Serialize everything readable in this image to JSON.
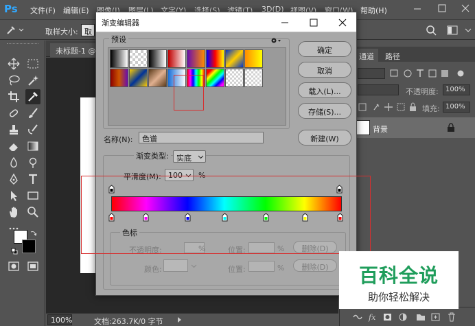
{
  "app": {
    "logo": "Ps",
    "menu": [
      "文件(F)",
      "编辑(E)",
      "图像(I)",
      "图层(L)",
      "文字(Y)",
      "选择(S)",
      "滤镜(T)",
      "3D(D)",
      "视图(V)",
      "窗口(W)",
      "帮助(H)"
    ]
  },
  "options_bar": {
    "sample_size_label": "取样大小:",
    "sample_size_value": "取"
  },
  "document": {
    "tab_title": "未标题-1 @",
    "zoom": "100%",
    "status": "文档:263.7K/0 字节"
  },
  "layers_panel": {
    "tabs": [
      "通道",
      "路径"
    ],
    "opacity_label": "不透明度:",
    "opacity_value": "100%",
    "fill_label": "填充:",
    "fill_value": "100%",
    "layer_name": "背景"
  },
  "dialog": {
    "title": "渐变编辑器",
    "presets_label": "预设",
    "buttons": {
      "ok": "确定",
      "cancel": "取消",
      "load": "载入(L)...",
      "save": "存储(S)...",
      "new": "新建(W)"
    },
    "name_label": "名称(N):",
    "name_value": "色谱",
    "gradient_type_label": "渐变类型:",
    "gradient_type_value": "实底",
    "smoothness_label": "平滑度(M):",
    "smoothness_value": "100",
    "smoothness_unit": "%",
    "stops": {
      "group_label": "色标",
      "opacity_label": "不透明度:",
      "opacity_unit": "%",
      "location_label": "位置:",
      "location_unit": "%",
      "delete_label": "删除(D)",
      "color_label": "颜色:",
      "location2_label": "位置:",
      "location2_unit": "%",
      "delete2_label": "删除(D)"
    },
    "selected_preset": "色谱",
    "gradient_colors": [
      "#ff0000",
      "#ff00ff",
      "#0000ff",
      "#00ffff",
      "#00ff00",
      "#ffff00",
      "#ff0000"
    ]
  },
  "watermark": {
    "main": "百科全说",
    "sub": "助你轻松解决"
  }
}
